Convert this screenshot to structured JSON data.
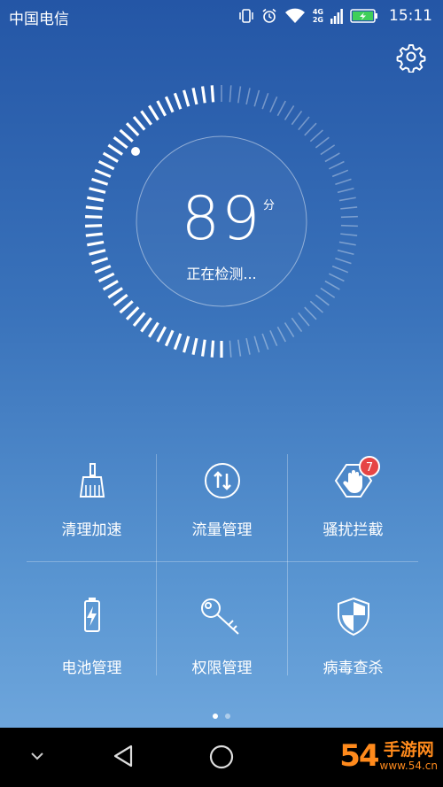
{
  "status_bar": {
    "carrier": "中国电信",
    "net_top": "4G",
    "net_bottom": "2G",
    "time": "15:11"
  },
  "gauge": {
    "score": "89",
    "unit": "分",
    "status": "正在检测...",
    "progress": 0.5
  },
  "grid": {
    "items": [
      {
        "label": "清理加速",
        "icon": "broom-icon"
      },
      {
        "label": "流量管理",
        "icon": "data-traffic-icon"
      },
      {
        "label": "骚扰拦截",
        "icon": "harassment-block-icon",
        "badge": "7"
      },
      {
        "label": "电池管理",
        "icon": "battery-icon"
      },
      {
        "label": "权限管理",
        "icon": "key-icon"
      },
      {
        "label": "病毒查杀",
        "icon": "shield-icon"
      }
    ]
  },
  "pager": {
    "count": 2,
    "active": 0
  },
  "watermark": {
    "number": "54",
    "name": "手游网",
    "url": "www.54.cn"
  },
  "colors": {
    "badge": "#e64545",
    "background_top": "#2456a6",
    "background_bottom": "#6ea6dc",
    "watermark": "#ff8a1c"
  }
}
